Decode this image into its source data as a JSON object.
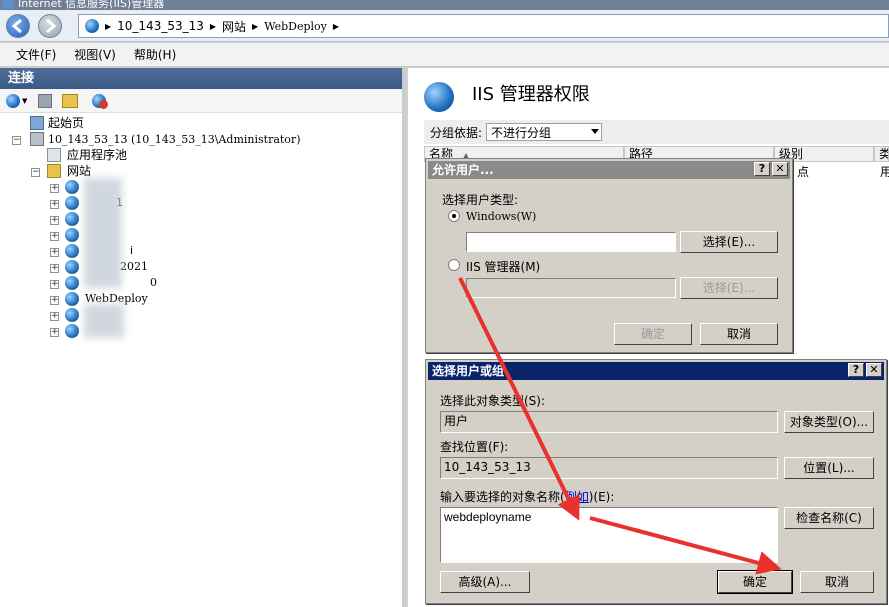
{
  "window": {
    "title": "Internet 信息服务(IIS)管理器"
  },
  "address": {
    "crumbs": [
      "10_143_53_13",
      "网站",
      "WebDeploy"
    ]
  },
  "menu": {
    "file": "文件(F)",
    "view": "视图(V)",
    "help": "帮助(H)"
  },
  "connections": {
    "header": "连接",
    "start_page": "起始页",
    "server": "10_143_53_13 (10_143_53_13\\Administrator)",
    "app_pools": "应用程序池",
    "sites": "网站",
    "site_fragments": [
      "1",
      "i",
      "2021",
      "0"
    ],
    "selected_site": "WebDeploy"
  },
  "feature": {
    "title": "IIS 管理器权限",
    "group_label": "分组依据:",
    "group_value": "不进行分组",
    "columns": {
      "name": "名称",
      "path": "路径",
      "level": "级别",
      "type": "类"
    },
    "row_level": "点",
    "row_type": "用"
  },
  "allow_user_dialog": {
    "title": "允许用户...",
    "help": "?",
    "close": "✕",
    "select_type_label": "选择用户类型:",
    "windows_option": "Windows(W)",
    "select_btn": "选择(E)...",
    "iis_option": "IIS 管理器(M)",
    "select_btn2": "选择(E)...",
    "ok": "确定",
    "cancel": "取消"
  },
  "select_user_dialog": {
    "title": "选择用户或组",
    "help": "?",
    "close": "✕",
    "object_type_label": "选择此对象类型(S):",
    "object_type_value": "用户",
    "object_type_btn": "对象类型(O)...",
    "location_label": "查找位置(F):",
    "location_value": "10_143_53_13",
    "location_btn": "位置(L)...",
    "names_label_pre": "输入要选择的对象名称(",
    "names_label_link": "例如",
    "names_label_post": ")(E):",
    "names_value": "webdeployname",
    "check_names_btn": "检查名称(C)",
    "advanced_btn": "高级(A)...",
    "ok": "确定",
    "cancel": "取消"
  },
  "colors": {
    "annotation_arrow": "#e8322b",
    "active_title": "#0a246a",
    "panel_header": "#3f5f8c"
  }
}
